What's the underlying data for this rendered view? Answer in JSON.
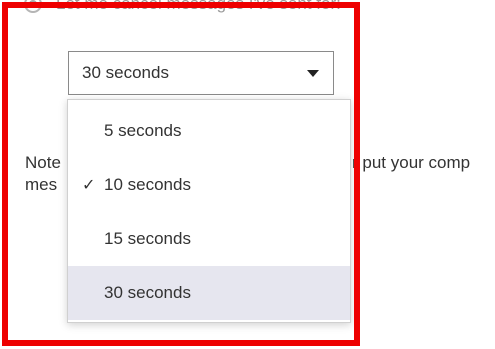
{
  "radio": {
    "label": "Let me cancel messages I've sent for:"
  },
  "select": {
    "value": "30 seconds"
  },
  "note": {
    "line1_left": "Note",
    "line1_right": "r put your comp",
    "line2_left": "mes"
  },
  "dropdown": {
    "options": [
      {
        "label": "5 seconds",
        "checked": false,
        "highlighted": false
      },
      {
        "label": "10 seconds",
        "checked": true,
        "highlighted": false
      },
      {
        "label": "15 seconds",
        "checked": false,
        "highlighted": false
      },
      {
        "label": "30 seconds",
        "checked": false,
        "highlighted": true
      }
    ],
    "check_glyph": "✓"
  },
  "colors": {
    "highlight": "#e6e6ef",
    "annotation_frame": "#ee0000"
  }
}
